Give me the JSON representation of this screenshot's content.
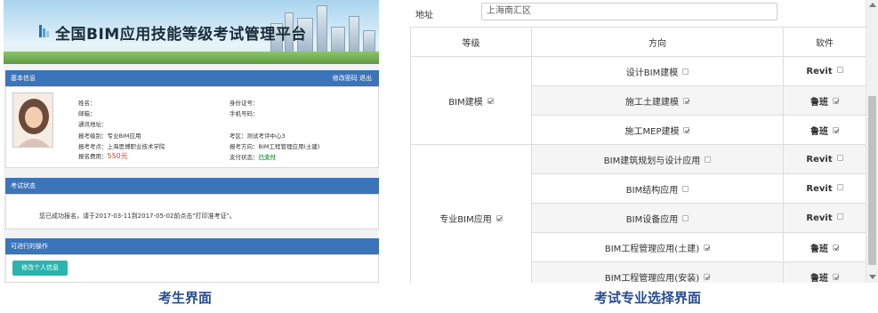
{
  "left": {
    "banner_title": "全国BIM应用技能等级考试管理平台",
    "basic_info": {
      "header": "基本信息",
      "actions": "修改密码 退出",
      "fields": {
        "name": "姓名：",
        "id_no": "身份证号：",
        "email": "邮箱：",
        "phone": "手机号码：",
        "address": "通讯地址：",
        "level": "报考级别：专业BIM应用",
        "exam_area": "考区：测试考评中心3",
        "exam_site": "报考考点：上海思博职业技术学院",
        "direction": "报考方向：BIM工程管理应用(土建)",
        "fee_label": "报名费用：",
        "fee_value": "550元",
        "pay_label": "支付状态：",
        "pay_value": "已支付"
      }
    },
    "exam_status": {
      "header": "考试状态",
      "notice": "您已成功报名，请于2017-03-11到2017-05-02前点击\"打印准考证\"。"
    },
    "operations": {
      "header": "可进行的操作",
      "edit_button": "修改个人信息"
    },
    "caption": "考生界面"
  },
  "right": {
    "address_label": "地址",
    "address_value": "上海南汇区",
    "headers": {
      "level": "等级",
      "direction": "方向",
      "software": "软件"
    },
    "levels": [
      {
        "label": "BIM建模",
        "checked": true
      },
      {
        "label": "专业BIM应用",
        "checked": true
      }
    ],
    "rows": [
      {
        "direction": "设计BIM建模",
        "dir_checked": false,
        "software": "Revit",
        "sw_checked": false
      },
      {
        "direction": "施工土建建模",
        "dir_checked": true,
        "software": "鲁班",
        "sw_checked": true
      },
      {
        "direction": "施工MEP建模",
        "dir_checked": true,
        "software": "鲁班",
        "sw_checked": true
      },
      {
        "direction": "BIM建筑规划与设计应用",
        "dir_checked": false,
        "software": "Revit",
        "sw_checked": false
      },
      {
        "direction": "BIM结构应用",
        "dir_checked": false,
        "software": "Revit",
        "sw_checked": false
      },
      {
        "direction": "BIM设备应用",
        "dir_checked": false,
        "software": "Revit",
        "sw_checked": false
      },
      {
        "direction": "BIM工程管理应用(土建)",
        "dir_checked": true,
        "software": "鲁班",
        "sw_checked": true
      },
      {
        "direction": "BIM工程管理应用(安装)",
        "dir_checked": true,
        "software": "鲁班",
        "sw_checked": true
      }
    ],
    "caption": "考试专业选择界面"
  },
  "colors": {
    "section_header": "#3b74b8",
    "fee_red": "#e03c1e",
    "paid_green": "#27a043",
    "button_teal": "#2cb4ae",
    "caption_blue": "#2a4d8f"
  }
}
